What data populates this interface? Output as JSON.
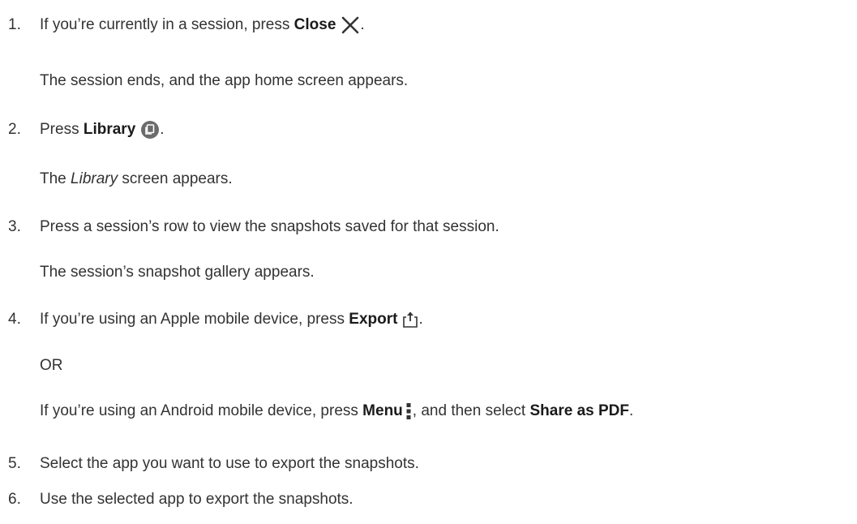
{
  "steps": [
    {
      "number": "1.",
      "text_before": "If you’re currently in a session, press ",
      "bold": "Close",
      "icon": "close-icon",
      "text_after": ".",
      "result": "The session ends, and the app home screen appears."
    },
    {
      "number": "2.",
      "text_before": "Press ",
      "bold": "Library",
      "icon": "library-icon",
      "text_after": ".",
      "result_before": "The ",
      "result_italic": "Library",
      "result_after": " screen appears."
    },
    {
      "number": "3.",
      "text": "Press a session’s row to view the snapshots saved for that session.",
      "result": "The session’s snapshot gallery appears."
    },
    {
      "number": "4.",
      "text_before": "If you’re using an Apple mobile device, press ",
      "bold": "Export",
      "icon": "export-icon",
      "text_after": ".",
      "or": "OR",
      "alt_before": "If you’re using an Android mobile device, press ",
      "alt_bold": "Menu",
      "alt_icon": "menu-icon",
      "alt_middle": ", and then select ",
      "alt_bold2": "Share as PDF",
      "alt_after": "."
    },
    {
      "number": "5.",
      "text": "Select the app you want to use to export the snapshots."
    },
    {
      "number": "6.",
      "text": "Use the selected app to export the snapshots."
    }
  ]
}
